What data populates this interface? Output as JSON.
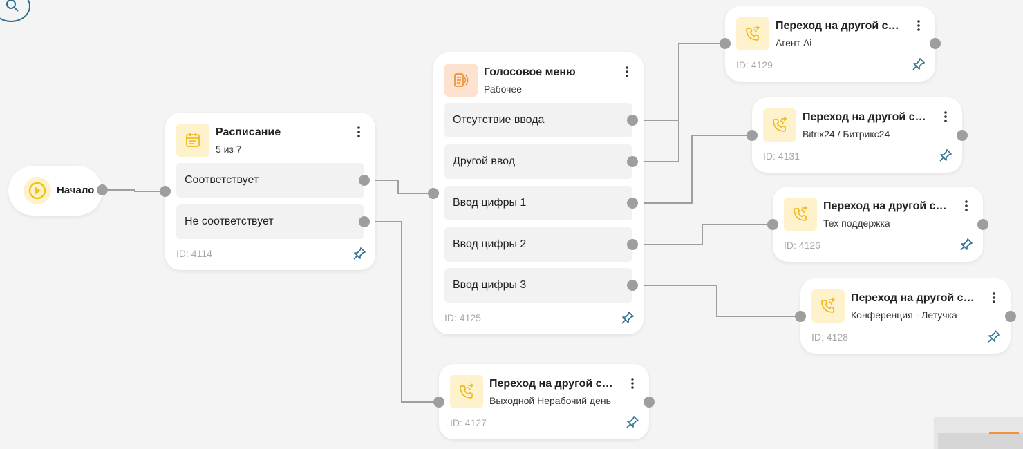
{
  "canvas": {
    "background": "#f4f4f4",
    "edge_color": "#9e9e9e",
    "port_color": "#9e9e9e"
  },
  "toolbar": {
    "search_icon": "search-icon"
  },
  "start_node": {
    "label": "Начало",
    "icon": "play-icon"
  },
  "nodes": {
    "schedule": {
      "title": "Расписание",
      "subtitle": "5 из 7",
      "icon": "calendar-icon",
      "options": [
        "Соответствует",
        "Не соответствует"
      ],
      "id_label": "ID: 4114"
    },
    "voice_menu": {
      "title": "Голосовое меню",
      "subtitle": "Рабочее",
      "icon": "speaker-icon",
      "options": [
        "Отсутствие ввода",
        "Другой ввод",
        "Ввод цифры 1",
        "Ввод цифры 2",
        "Ввод цифры 3"
      ],
      "id_label": "ID: 4125"
    },
    "transfer_4129": {
      "title": "Переход на другой сце...",
      "subtitle": "Агент Ai",
      "icon": "phone-transfer-icon",
      "id_label": "ID: 4129"
    },
    "transfer_4131": {
      "title": "Переход на другой сце...",
      "subtitle": "Bitrix24 / Битрикс24",
      "icon": "phone-transfer-icon",
      "id_label": "ID: 4131"
    },
    "transfer_4126": {
      "title": "Переход на другой сце...",
      "subtitle": "Тех поддержка",
      "icon": "phone-transfer-icon",
      "id_label": "ID: 4126"
    },
    "transfer_4128": {
      "title": "Переход на другой сце...",
      "subtitle": "Конференция - Летучка",
      "icon": "phone-transfer-icon",
      "id_label": "ID: 4128"
    },
    "transfer_4127": {
      "title": "Переход на другой сце...",
      "subtitle": "Выходной Нерабочий день",
      "icon": "phone-transfer-icon",
      "id_label": "ID: 4127"
    }
  },
  "connections": [
    {
      "from": "start",
      "to": "schedule"
    },
    {
      "from": "schedule: Соответствует",
      "to": "voice_menu"
    },
    {
      "from": "schedule: Не соответствует",
      "to": "transfer_4127"
    },
    {
      "from": "voice_menu: Отсутствие ввода",
      "to": "transfer_4129"
    },
    {
      "from": "voice_menu: Другой ввод",
      "to": "transfer_4129"
    },
    {
      "from": "voice_menu: Ввод цифры 1",
      "to": "transfer_4131"
    },
    {
      "from": "voice_menu: Ввод цифры 2",
      "to": "transfer_4126"
    },
    {
      "from": "voice_menu: Ввод цифры 3",
      "to": "transfer_4128"
    }
  ]
}
